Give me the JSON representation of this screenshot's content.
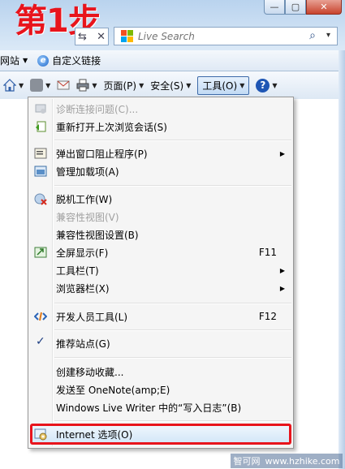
{
  "step_label": "第1步",
  "window_controls": {
    "minimize": "—",
    "restore": "▢",
    "close": "✕"
  },
  "address": {
    "arrows": "⇆",
    "close": "✕"
  },
  "search": {
    "placeholder": "Live Search",
    "go_icon": "⌕",
    "dropdown": "▾"
  },
  "favorites_bar": {
    "items": [
      {
        "label": "网站",
        "dropdown": "▼"
      },
      {
        "label": "自定义链接"
      }
    ]
  },
  "command_bar": {
    "home_dropdown": "▼",
    "feeds_dropdown": "▼",
    "print_dropdown": "▼",
    "page_label": "页面(P)",
    "page_dropdown": "▼",
    "safety_label": "安全(S)",
    "safety_dropdown": "▼",
    "tools_label": "工具(O)",
    "tools_dropdown": "▼",
    "help_label": "?",
    "help_dropdown": "▼"
  },
  "tools_menu": {
    "items": [
      {
        "label": "诊断连接问题(C)...",
        "disabled": true,
        "icon": "diagnose-icon"
      },
      {
        "label": "重新打开上次浏览会话(S)",
        "icon": "reopen-session-icon"
      },
      {
        "label": "弹出窗口阻止程序(P)",
        "submenu": true,
        "icon": "popup-blocker-icon"
      },
      {
        "label": "管理加载项(A)",
        "icon": "addons-icon"
      },
      {
        "label": "脱机工作(W)",
        "icon": "offline-icon"
      },
      {
        "label": "兼容性视图(V)",
        "disabled": true
      },
      {
        "label": "兼容性视图设置(B)"
      },
      {
        "label": "全屏显示(F)",
        "shortcut": "F11",
        "icon": "fullscreen-icon"
      },
      {
        "label": "工具栏(T)",
        "submenu": true
      },
      {
        "label": "浏览器栏(X)",
        "submenu": true
      },
      {
        "label": "开发人员工具(L)",
        "shortcut": "F12",
        "icon": "developer-tools-icon"
      },
      {
        "label": "推荐站点(G)",
        "checked": true
      },
      {
        "label": "创建移动收藏..."
      },
      {
        "label": "发送至 OneNote(amp;E)"
      },
      {
        "label": "Windows Live Writer 中的“写入日志”(B)"
      },
      {
        "label": "Internet 选项(O)",
        "highlighted": true,
        "icon": "internet-options-icon"
      }
    ],
    "submenu_arrow": "▶",
    "check_mark": "✓"
  },
  "watermark": {
    "left": "智可网",
    "right": "www.hzhike.com"
  },
  "colors": {
    "step_label": "#e8141c",
    "highlight_border": "#e8141c",
    "chrome_blue": "#b9d3ee",
    "menu_background": "#f5f5f5"
  }
}
